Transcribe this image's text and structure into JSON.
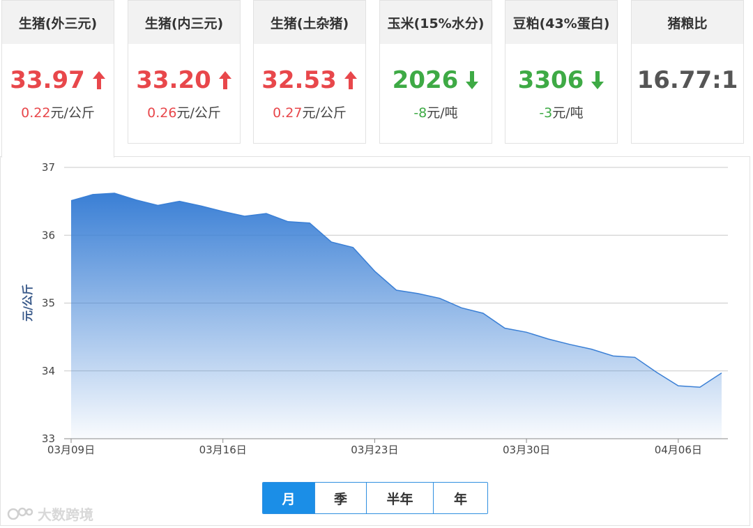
{
  "cards": [
    {
      "title": "生猪(外三元)",
      "value": "33.97",
      "direction": "up",
      "change": "0.22",
      "unit": "元/公斤",
      "color": "#e8474b"
    },
    {
      "title": "生猪(内三元)",
      "value": "33.20",
      "direction": "up",
      "change": "0.26",
      "unit": "元/公斤",
      "color": "#e8474b"
    },
    {
      "title": "生猪(土杂猪)",
      "value": "32.53",
      "direction": "up",
      "change": "0.27",
      "unit": "元/公斤",
      "color": "#e8474b"
    },
    {
      "title": "玉米(15%水分)",
      "value": "2026",
      "direction": "down",
      "change": "-8",
      "unit": "元/吨",
      "color": "#3eaa45"
    },
    {
      "title": "豆粕(43%蛋白)",
      "value": "3306",
      "direction": "down",
      "change": "-3",
      "unit": "元/吨",
      "color": "#3eaa45"
    },
    {
      "title": "猪粮比",
      "value": "16.77:1",
      "direction": "none",
      "change": "",
      "unit": "",
      "color": "#555555"
    }
  ],
  "range_tabs": [
    "月",
    "季",
    "半年",
    "年"
  ],
  "active_range": "月",
  "watermark": "大数跨境",
  "chart_data": {
    "type": "area",
    "ylabel": "元/公斤",
    "ylim": [
      33,
      37
    ],
    "yticks": [
      33,
      34,
      35,
      36,
      37
    ],
    "xticks": [
      "03月09日",
      "03月16日",
      "03月23日",
      "03月30日",
      "04月06日"
    ],
    "grid": true,
    "color": "#3a7fd5",
    "x": [
      "03-09",
      "03-10",
      "03-11",
      "03-12",
      "03-13",
      "03-14",
      "03-15",
      "03-16",
      "03-17",
      "03-18",
      "03-19",
      "03-20",
      "03-21",
      "03-22",
      "03-23",
      "03-24",
      "03-25",
      "03-26",
      "03-27",
      "03-28",
      "03-29",
      "03-30",
      "03-31",
      "04-01",
      "04-02",
      "04-03",
      "04-04",
      "04-05",
      "04-06",
      "04-07",
      "04-08"
    ],
    "values": [
      36.51,
      36.6,
      36.62,
      36.52,
      36.44,
      36.5,
      36.43,
      36.35,
      36.28,
      36.32,
      36.2,
      36.18,
      35.9,
      35.82,
      35.47,
      35.19,
      35.14,
      35.07,
      34.93,
      34.85,
      34.63,
      34.57,
      34.47,
      34.39,
      34.32,
      34.22,
      34.2,
      33.98,
      33.78,
      33.76,
      33.97
    ]
  }
}
